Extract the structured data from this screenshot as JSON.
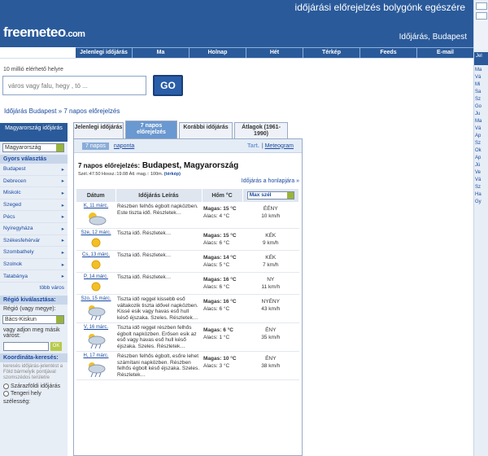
{
  "header": {
    "logo_free": "freemeteo",
    "logo_com": ".com",
    "tagline": "időjárási előrejelzés bolygónk egészére",
    "city_title": "Időjárás, Budapest"
  },
  "nav": [
    "Jelenlegi időjárás",
    "Ma",
    "Holnap",
    "Hét",
    "Térkép",
    "Feeds",
    "E-mail"
  ],
  "search": {
    "counter": "10 millió elérhető helyre",
    "placeholder": "város vagy falu, hegy , tó ...",
    "go": "GO"
  },
  "breadcrumb": "Időjárás Budapest » 7 napos előrejelzés",
  "left": {
    "country_header": "Magyarország időjárás",
    "country_select": "Magyarország",
    "quick_header": "Gyors választás",
    "cities": [
      "Budapest",
      "Debrecen",
      "Miskolc",
      "Szeged",
      "Pécs",
      "Nyíregyháza",
      "Székesfehérvár",
      "Szombathely",
      "Szolnok",
      "Tatabánya"
    ],
    "more": "több város",
    "region_header": "Régió kiválasztása:",
    "region_label": "Régió (vagy megye):",
    "region_select": "Bács-Kiskun",
    "city_label": "vagy adjon meg másik várost:",
    "ok": "OK",
    "coord_header": "Koordináta-keresés:",
    "coord_text": "keresés időjárás-jelentést a Föld bármelyik pontjával szomszédos területre",
    "radio1": "Szárazföldi időjárás",
    "radio2": "Tengeri hely",
    "lat_label": "szélesség:"
  },
  "tabs": [
    "Jelenlegi időjárás",
    "7 napos előrejelzés",
    "Korábbi időjárás",
    "Átlagok (1961-1990)"
  ],
  "subbar": {
    "days7": "7 napos",
    "daily": "naponta",
    "tart": "Tart.",
    "meteogram": "Meteogram"
  },
  "forecast": {
    "label": "7 napos előrejelzés:",
    "city": "Budapest, Magyarország",
    "coords": "Szél.:47.50 Hossz.:19.08 Átl. mag.:: 100m.",
    "map_link": "(térkép)",
    "homepage": "Időjárás a honlapjára »",
    "headers": [
      "Dátum",
      "Időjárás Leírás",
      "Hőm °C"
    ],
    "wind_select": "Max szél",
    "rows": [
      {
        "date": "K, 11 márc.",
        "desc": "Részben felhős égbolt napközben. Este tiszta idő. Részletek…",
        "high": "Magas: 15 °C",
        "low": "Alacs: 4 °C",
        "dir": "ÉÉNY",
        "speed": "10 km/h",
        "icon": "cloud-sun-icon"
      },
      {
        "date": "Sze, 12 márc.",
        "desc": "Tiszta idő. Részletek…",
        "high": "Magas: 15 °C",
        "low": "Alacs: 6 °C",
        "dir": "KÉK",
        "speed": "9 km/h",
        "icon": "sun-icon"
      },
      {
        "date": "Cs, 13 márc.",
        "desc": "Tiszta idő. Részletek…",
        "high": "Magas: 14 °C",
        "low": "Alacs: 5 °C",
        "dir": "KÉK",
        "speed": "7 km/h",
        "icon": "sun-icon"
      },
      {
        "date": "P, 14 márc.",
        "desc": "Tiszta idő. Részletek…",
        "high": "Magas: 16 °C",
        "low": "Alacs: 6 °C",
        "dir": "NY",
        "speed": "11 km/h",
        "icon": "sun-icon"
      },
      {
        "date": "Szo, 15 márc.",
        "desc": "Tiszta idő reggel kissebb eső váltakozik tiszta idővel napközben. Kissé esik vagy havas eső hull késő éjszaka. Szeles. Részletek…",
        "high": "Magas: 16 °C",
        "low": "Alacs: 6 °C",
        "dir": "NYÉNY",
        "speed": "43 km/h",
        "icon": "rain-cloud-icon"
      },
      {
        "date": "V, 16 márc.",
        "desc": "Tiszta idő reggel részben felhős égbolt napközben. Erősen esik az eső vagy havas eső hull késő éjszaka. Szeles. Részletek…",
        "high": "Magas: 6 °C",
        "low": "Alacs: 1 °C",
        "dir": "ÉNY",
        "speed": "35 km/h",
        "icon": "rain-cloud-icon"
      },
      {
        "date": "H, 17 márc.",
        "desc": "Részben felhős égbolt, esőre lehet számítani napközben. Részben felhős égbolt késő éjszaka. Szeles. Részletek…",
        "high": "Magas: 10 °C",
        "low": "Alacs: 3 °C",
        "dir": "ÉNY",
        "speed": "38 km/h",
        "icon": "rain-cloud-icon"
      }
    ]
  },
  "rightstrip": {
    "hd": "Jel",
    "items": [
      "Ma",
      "Vá",
      "Mi",
      "Sa",
      "Sz",
      "Go",
      "Ju",
      "Ma",
      "Vá",
      "Ap",
      "Sz",
      "Ok",
      "Ap",
      "Jú",
      "Ve",
      "Vá",
      "Sz",
      "Ha",
      "Gy"
    ]
  }
}
